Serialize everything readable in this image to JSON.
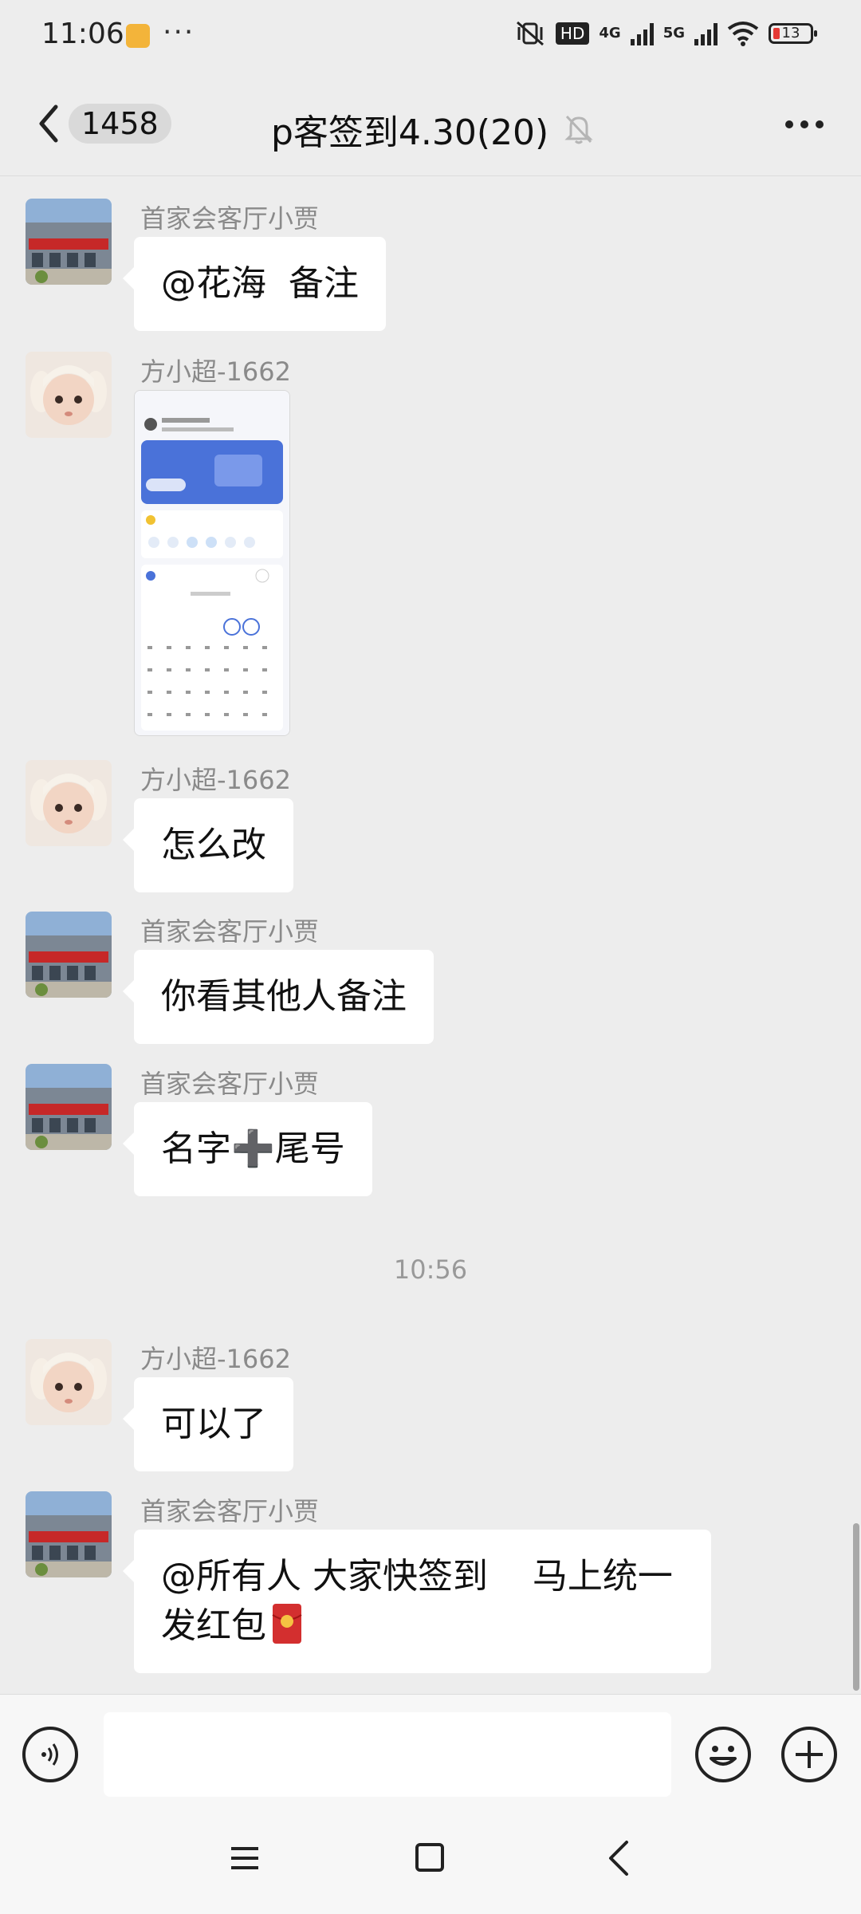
{
  "status_bar": {
    "time": "11:06",
    "dots": "···",
    "hd_label": "HD",
    "net_4g": "4G",
    "net_5g": "5G",
    "battery": "13"
  },
  "header": {
    "unread_count": "1458",
    "title": "p客签到4.30(20)"
  },
  "messages": [
    {
      "sender": "首家会客厅小贾",
      "text": "@花海  备注",
      "avatar": "building"
    },
    {
      "sender": "方小超-1662",
      "type": "image",
      "avatar": "baby"
    },
    {
      "sender": "方小超-1662",
      "text": "怎么改",
      "avatar": "baby"
    },
    {
      "sender": "首家会客厅小贾",
      "text": "你看其他人备注",
      "avatar": "building"
    },
    {
      "sender": "首家会客厅小贾",
      "text": "名字➕尾号",
      "avatar": "building"
    },
    {
      "sender": "方小超-1662",
      "text": "可以了",
      "avatar": "baby"
    },
    {
      "sender": "首家会客厅小贾",
      "text": "@所有人 大家快签到    马上统一\n发红包",
      "avatar": "building",
      "emoji": "red-envelope"
    }
  ],
  "timestamp": "10:56",
  "input": {
    "value": ""
  },
  "icons": {
    "back": "chevron-left-icon",
    "mute": "bell-off-icon",
    "more": "more-dots-icon",
    "voice": "voice-icon",
    "emoji": "smile-icon",
    "plus": "plus-icon"
  }
}
